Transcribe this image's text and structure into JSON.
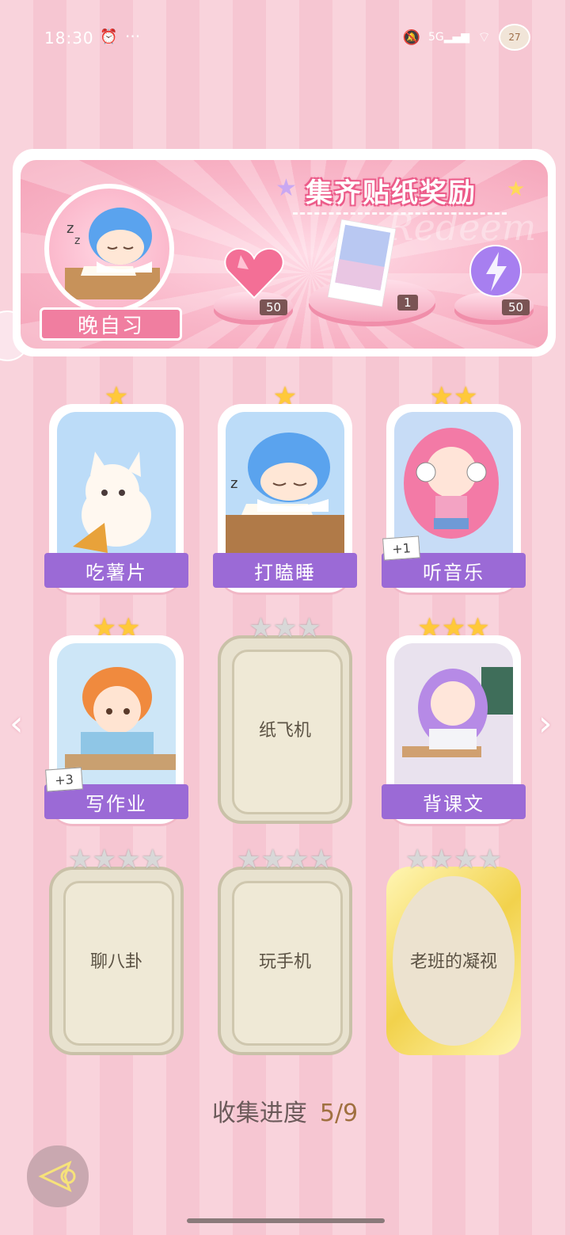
{
  "status_bar": {
    "time": "18:30",
    "dots": "···",
    "network": "5G",
    "battery": "27"
  },
  "reward_panel": {
    "title": "集齐贴纸奖励",
    "watermark": "Redeem",
    "current_sticker_label": "晚自习",
    "rewards": [
      {
        "icon": "heart-gem-icon",
        "count": "50"
      },
      {
        "icon": "photo-card-icon",
        "count": "1"
      },
      {
        "icon": "lightning-orb-icon",
        "count": "50"
      }
    ]
  },
  "stickers": [
    {
      "label": "吃薯片",
      "stars": 1,
      "unlocked": true,
      "plus": ""
    },
    {
      "label": "打瞌睡",
      "stars": 1,
      "unlocked": true,
      "plus": ""
    },
    {
      "label": "听音乐",
      "stars": 2,
      "unlocked": true,
      "plus": "+1"
    },
    {
      "label": "写作业",
      "stars": 2,
      "unlocked": true,
      "plus": "+3"
    },
    {
      "label": "纸飞机",
      "stars": 3,
      "unlocked": false,
      "plus": ""
    },
    {
      "label": "背课文",
      "stars": 3,
      "unlocked": true,
      "plus": ""
    },
    {
      "label": "聊八卦",
      "stars": 4,
      "unlocked": false,
      "plus": ""
    },
    {
      "label": "玩手机",
      "stars": 4,
      "unlocked": false,
      "plus": ""
    },
    {
      "label": "老班的凝视",
      "stars": 4,
      "unlocked": false,
      "plus": ""
    }
  ],
  "progress": {
    "label": "收集进度",
    "value": "5/9"
  },
  "colors": {
    "accent_purple": "#9b6ad6",
    "pink": "#f07ea0",
    "gold_star": "#ffc93a"
  }
}
